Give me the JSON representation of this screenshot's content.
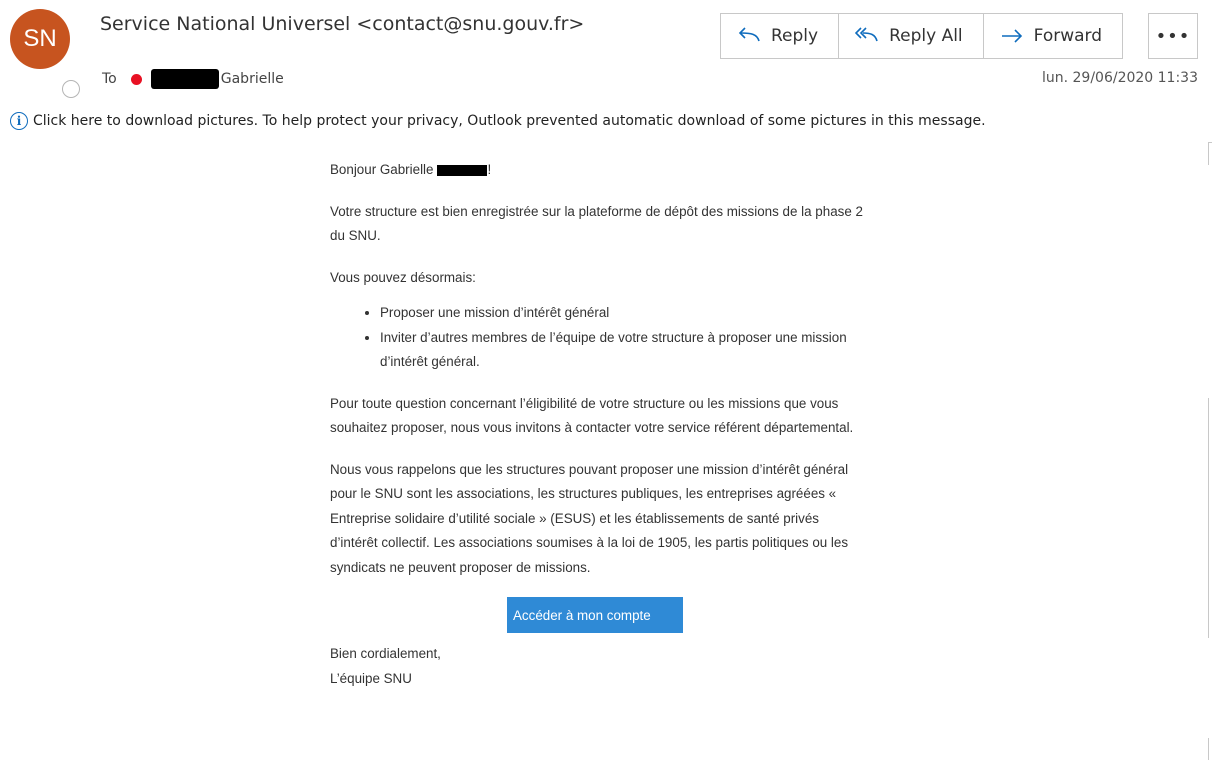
{
  "header": {
    "avatar_initials": "SN",
    "sender": "Service National Universel <contact@snu.gouv.fr>",
    "to_label": "To",
    "recipient": "Gabrielle",
    "date": "lun. 29/06/2020 11:33"
  },
  "actions": [
    {
      "label": "Reply",
      "icon": "reply-icon"
    },
    {
      "label": "Reply All",
      "icon": "reply-all-icon"
    },
    {
      "label": "Forward",
      "icon": "forward-icon"
    }
  ],
  "more_label": "•••",
  "info_bar": {
    "icon": "i",
    "text": "Click here to download pictures. To help protect your privacy, Outlook prevented automatic download of some pictures in this message."
  },
  "email": {
    "greeting_start": "Bonjour Gabrielle",
    "greeting_end": "!",
    "p1": "Votre structure est bien enregistrée sur la plateforme de dépôt des missions de la phase 2 du SNU.",
    "p2": "Vous pouvez désormais:",
    "bullets": [
      "Proposer une mission d’intérêt général",
      "Inviter d’autres membres de l’équipe de votre structure à proposer une mission d’intérêt général."
    ],
    "p3": "Pour toute question concernant l’éligibilité de votre structure ou les missions que vous souhaitez proposer, nous vous invitons à contacter votre service référent départemental.",
    "p4": "Nous vous rappelons que les structures pouvant proposer une mission d’intérêt général pour le SNU sont les associations, les structures publiques, les entreprises agréées « Entreprise solidaire d’utilité sociale » (ESUS) et les établissements de santé privés d’intérêt collectif. Les associations soumises à la loi de 1905, les partis politiques ou les syndicats ne peuvent proposer de missions.",
    "cta": "Accéder à mon compte",
    "signoff": "Bien cordialement,",
    "signature": "L’équipe SNU"
  },
  "colors": {
    "avatar": "#c7541f",
    "accent": "#2f8ad6",
    "presence_red": "#e81123",
    "info_blue": "#0f6cbd"
  }
}
